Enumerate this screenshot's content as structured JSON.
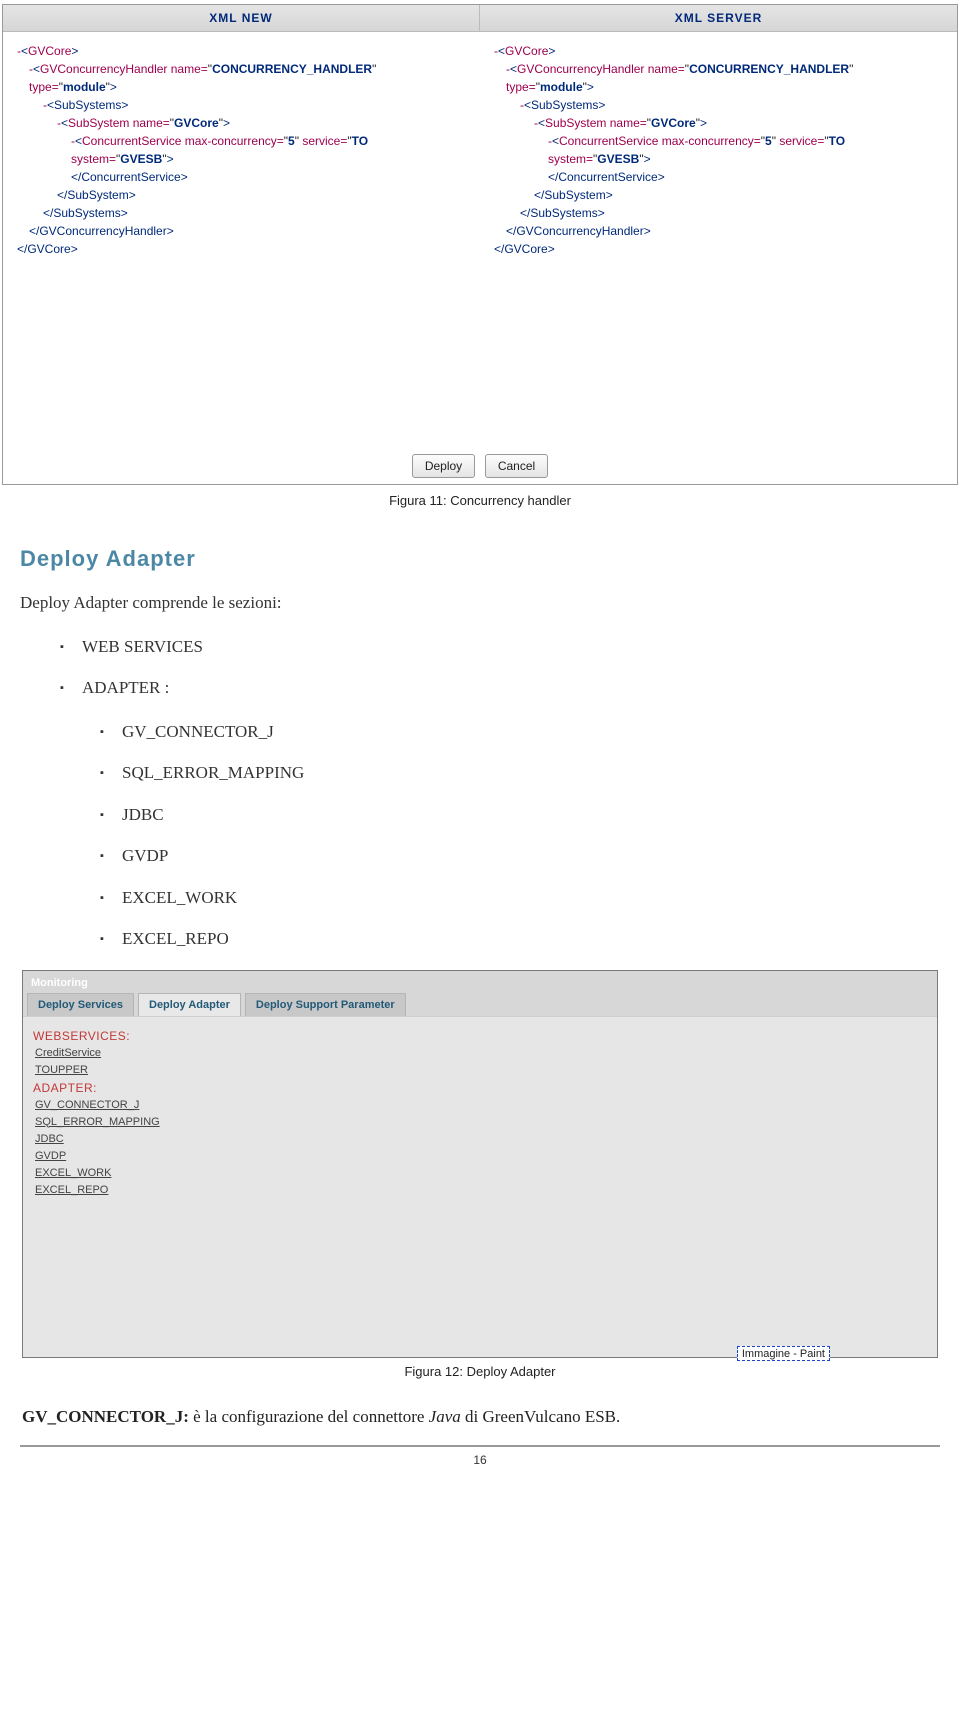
{
  "compare": {
    "left_header": "XML NEW",
    "right_header": "XML SERVER",
    "xml": {
      "l0_open": "<GVCore>",
      "l1_tag": "GVConcurrencyHandler",
      "l1_attr_name": "name",
      "l1_attr_val": "CONCURRENCY_HANDLER",
      "l2_attr_name": "type",
      "l2_attr_val": "module",
      "l3_open": "<SubSystems>",
      "l4_tag": "SubSystem",
      "l4_attr_name": "name",
      "l4_attr_val": "GVCore",
      "l5_tag": "ConcurrentService",
      "l5_a1_name": "max-concurrency",
      "l5_a1_val": "5",
      "l5_a2_name": "service",
      "l5_a2_val": "TO",
      "l6_attr_name": "system",
      "l6_attr_val": "GVESB",
      "l7_close": "</ConcurrentService>",
      "l8_close": "</SubSystem>",
      "l9_close": "</SubSystems>",
      "l10_close": "</GVConcurrencyHandler>",
      "l11_close": "</GVCore>"
    }
  },
  "buttons": {
    "deploy": "Deploy",
    "cancel": "Cancel"
  },
  "caption1": "Figura 11: Concurrency handler",
  "section_heading": "Deploy Adapter",
  "intro_text": "Deploy Adapter comprende le sezioni:",
  "bullets": [
    "WEB SERVICES",
    "ADAPTER :"
  ],
  "sub_bullets": [
    "GV_CONNECTOR_J",
    "SQL_ERROR_MAPPING",
    "JDBC",
    "GVDP",
    "EXCEL_WORK",
    "EXCEL_REPO"
  ],
  "fig2": {
    "crumb": "Monitoring",
    "tabs": [
      "Deploy Services",
      "Deploy Adapter",
      "Deploy Support Parameter"
    ],
    "cat1": "WEBSERVICES:",
    "ws_links": [
      "CreditService",
      "TOUPPER"
    ],
    "cat2": "ADAPTER:",
    "ad_links": [
      "GV_CONNECTOR_J",
      "SQL_ERROR_MAPPING",
      "JDBC",
      "GVDP",
      "EXCEL_WORK",
      "EXCEL_REPO"
    ],
    "paint": "Immagine - Paint"
  },
  "caption2": "Figura 12: Deploy Adapter",
  "gvline": {
    "key": "GV_CONNECTOR_J:",
    "rest_a": " è la configurazione del connettore ",
    "rest_italic": "Java",
    "rest_b": " di GreenVulcano ESB."
  },
  "page_num": "16"
}
